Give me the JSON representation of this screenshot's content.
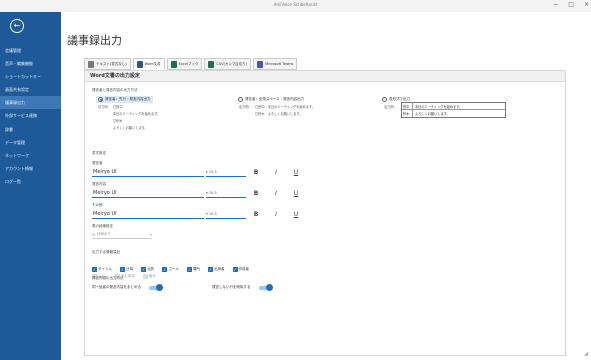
{
  "window": {
    "title": "AmiVoice ScribeAssist",
    "controls": [
      "−",
      "□",
      "×"
    ]
  },
  "sidebar": {
    "back_symbol": "←",
    "items": [
      {
        "label": "会議管理"
      },
      {
        "label": "音声・編集機能"
      },
      {
        "label": "ショートカットキー"
      },
      {
        "label": "画面共有設定"
      },
      {
        "label": "議事録出力"
      },
      {
        "label": "外部サービス連携"
      },
      {
        "label": "辞書"
      },
      {
        "label": "データ管理"
      },
      {
        "label": "ネットワーク"
      },
      {
        "label": "アカウント情報"
      },
      {
        "label": "ログ一覧"
      }
    ]
  },
  "page_title": "議事録出力",
  "tabs": [
    {
      "label": "テキスト(書式なし)",
      "color": "#7a7a7a"
    },
    {
      "label": "Word文書",
      "color": "#2b5797"
    },
    {
      "label": "Excelブック",
      "color": "#1e7145"
    },
    {
      "label": "CSV(カンマ区切り)",
      "color": "#1e7145"
    },
    {
      "label": "Microsoft Teams",
      "color": "#4b53bc"
    }
  ],
  "panel": {
    "header": "Word文書の出力設定",
    "order_label": "発言者と発言内容の出力方法",
    "options": [
      {
        "label": "発言者：先行・発言内容出力"
      },
      {
        "label": "発言者：全角スペース・発言内容出力"
      },
      {
        "label": "表形式で出力"
      }
    ],
    "example_label": "出力例：",
    "opt1_example": [
      "〇田中",
      "本日のミーティングを始めます。",
      "〇鈴木",
      "よろしくお願いします。"
    ],
    "opt2_example": [
      "〇田中　本日のミーティングを始めます。",
      "〇鈴木　よろしくお願いします。"
    ],
    "opt3_table": [
      {
        "speaker": "田中",
        "text": "本日のミーティングを始めます。"
      },
      {
        "speaker": "鈴木",
        "text": "よろしくお願いします。"
      }
    ],
    "font_section_label": "書式設定",
    "font_rows": [
      {
        "label": "発言者",
        "font": "Meiryo UI",
        "size": "10.5"
      },
      {
        "label": "発言内容",
        "font": "Meiryo UI",
        "size": "10.5"
      },
      {
        "label": "その他",
        "font": "Meiryo UI",
        "size": "10.5"
      }
    ],
    "fmt_buttons": [
      "B",
      "I",
      "U"
    ],
    "table_border_label": "表の枠線設定",
    "table_border_value": "枠線あり",
    "info_label": "出力する情報項目",
    "info_items": [
      {
        "label": "タイトル",
        "on": true
      },
      {
        "label": "日時",
        "on": true
      },
      {
        "label": "目的",
        "on": true
      },
      {
        "label": "ゴール",
        "on": true
      },
      {
        "label": "場所",
        "on": true
      },
      {
        "label": "出席者",
        "on": true
      },
      {
        "label": "作成者",
        "on": true
      }
    ],
    "info_items_disabled": [
      "ToDo",
      "決定事項",
      "備考"
    ],
    "output_method_label": "発言内容の出力方法",
    "toggle1_label": "同一話者の発言内容をまとめる",
    "toggle2_label": "発言しない行を削除する"
  }
}
